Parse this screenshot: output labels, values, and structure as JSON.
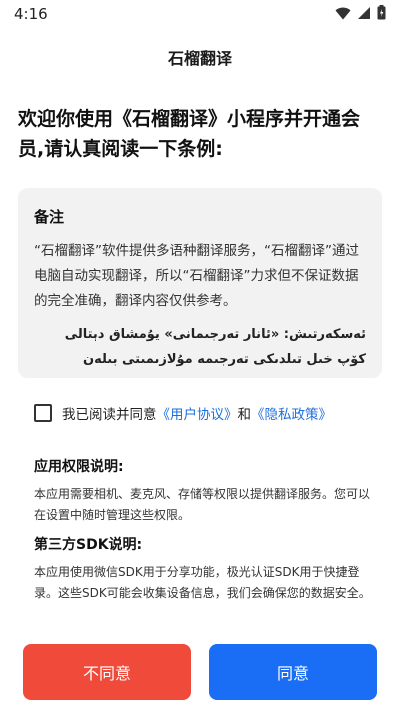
{
  "status": {
    "time": "4:16",
    "icons": [
      "wifi-icon",
      "signal-icon",
      "battery-icon"
    ]
  },
  "app": {
    "title": "石榴翻译"
  },
  "headline": "欢迎你使用《石榴翻译》小程序并开通会员,请认真阅读一下条例:",
  "notice": {
    "title": "备注",
    "body_cn": "“石榴翻译”软件提供多语种翻译服务，“石榴翻译”通过电脑自动实现翻译，所以“石榴翻译”力求但不保证数据的完全准确，翻译内容仅供参考。",
    "body_ug": "ئەسكەرتىش: «ئانار تەرجىمانى» يۇمشاق دېتالى كۆپ خىل تىلدىكى تەرجىمە مۇلازىمىتى بىلەن تەمىنلەيدۇ، «ئانار"
  },
  "agreement": {
    "prefix": "我已阅读并同意",
    "user_link": "《用户协议》",
    "conj": "和",
    "privacy_link": "《隐私政策》"
  },
  "permissions": {
    "title": "应用权限说明:",
    "text": "本应用需要相机、麦克风、存储等权限以提供翻译服务。您可以在设置中随时管理这些权限。"
  },
  "sdk": {
    "title": "第三方SDK说明:",
    "text": "本应用使用微信SDK用于分享功能，极光认证SDK用于快捷登录。这些SDK可能会收集设备信息，我们会确保您的数据安全。"
  },
  "buttons": {
    "disagree": "不同意",
    "agree": "同意"
  },
  "colors": {
    "disagree": "#f04a3a",
    "agree": "#1a6df5",
    "link": "#1e6fe0",
    "card_bg": "#f2f2f2"
  }
}
